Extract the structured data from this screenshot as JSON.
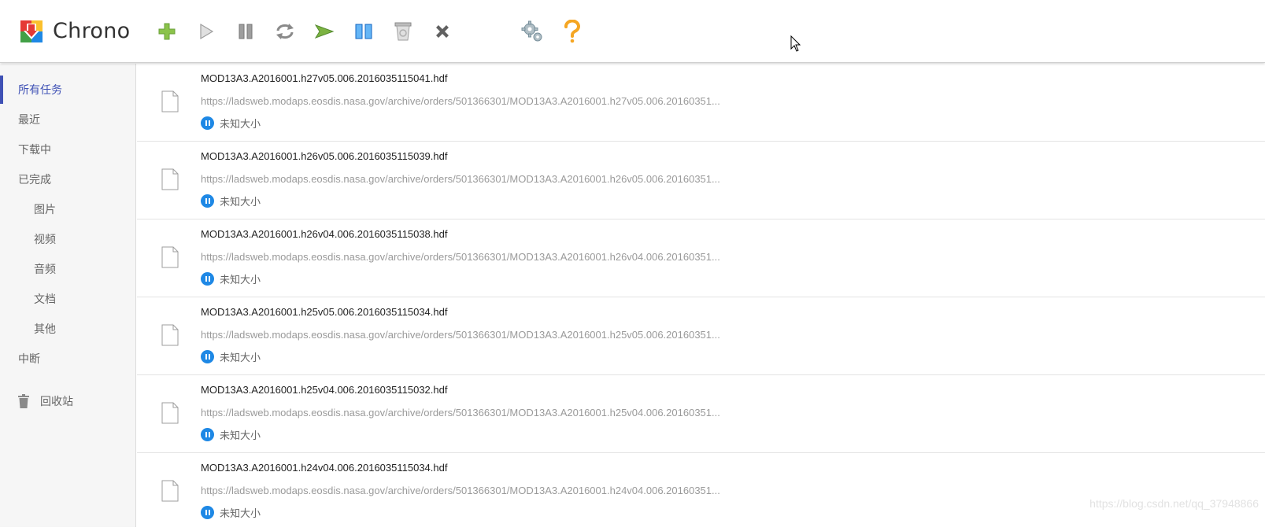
{
  "app": {
    "title": "Chrono",
    "accent": "#3f51b5",
    "status_color": "#1e88e5"
  },
  "toolbar": [
    {
      "name": "add",
      "icon": "plus-icon"
    },
    {
      "name": "start",
      "icon": "play-icon"
    },
    {
      "name": "pause",
      "icon": "pause-icon"
    },
    {
      "name": "retry",
      "icon": "refresh-icon"
    },
    {
      "name": "start-all",
      "icon": "play-green-icon"
    },
    {
      "name": "pause-all",
      "icon": "pause-blue-icon"
    },
    {
      "name": "delete",
      "icon": "recycle-bin-icon"
    },
    {
      "name": "remove",
      "icon": "close-icon"
    },
    {
      "name": "settings",
      "icon": "gear-icon"
    },
    {
      "name": "help",
      "icon": "question-icon"
    }
  ],
  "sidebar": {
    "items": [
      {
        "label": "所有任务",
        "level": 1,
        "active": true
      },
      {
        "label": "最近",
        "level": 1
      },
      {
        "label": "下载中",
        "level": 1
      },
      {
        "label": "已完成",
        "level": 1
      },
      {
        "label": "图片",
        "level": 2
      },
      {
        "label": "视频",
        "level": 2
      },
      {
        "label": "音频",
        "level": 2
      },
      {
        "label": "文档",
        "level": 2
      },
      {
        "label": "其他",
        "level": 2
      },
      {
        "label": "中断",
        "level": 1
      }
    ],
    "trash_label": "回收站"
  },
  "tasks": [
    {
      "name": "MOD13A3.A2016001.h27v05.006.2016035115041.hdf",
      "url": "https://ladsweb.modaps.eosdis.nasa.gov/archive/orders/501366301/MOD13A3.A2016001.h27v05.006.20160351...",
      "status": "未知大小"
    },
    {
      "name": "MOD13A3.A2016001.h26v05.006.2016035115039.hdf",
      "url": "https://ladsweb.modaps.eosdis.nasa.gov/archive/orders/501366301/MOD13A3.A2016001.h26v05.006.20160351...",
      "status": "未知大小"
    },
    {
      "name": "MOD13A3.A2016001.h26v04.006.2016035115038.hdf",
      "url": "https://ladsweb.modaps.eosdis.nasa.gov/archive/orders/501366301/MOD13A3.A2016001.h26v04.006.20160351...",
      "status": "未知大小"
    },
    {
      "name": "MOD13A3.A2016001.h25v05.006.2016035115034.hdf",
      "url": "https://ladsweb.modaps.eosdis.nasa.gov/archive/orders/501366301/MOD13A3.A2016001.h25v05.006.20160351...",
      "status": "未知大小"
    },
    {
      "name": "MOD13A3.A2016001.h25v04.006.2016035115032.hdf",
      "url": "https://ladsweb.modaps.eosdis.nasa.gov/archive/orders/501366301/MOD13A3.A2016001.h25v04.006.20160351...",
      "status": "未知大小"
    },
    {
      "name": "MOD13A3.A2016001.h24v04.006.2016035115034.hdf",
      "url": "https://ladsweb.modaps.eosdis.nasa.gov/archive/orders/501366301/MOD13A3.A2016001.h24v04.006.20160351...",
      "status": "未知大小"
    }
  ],
  "watermark": "https://blog.csdn.net/qq_37948866"
}
